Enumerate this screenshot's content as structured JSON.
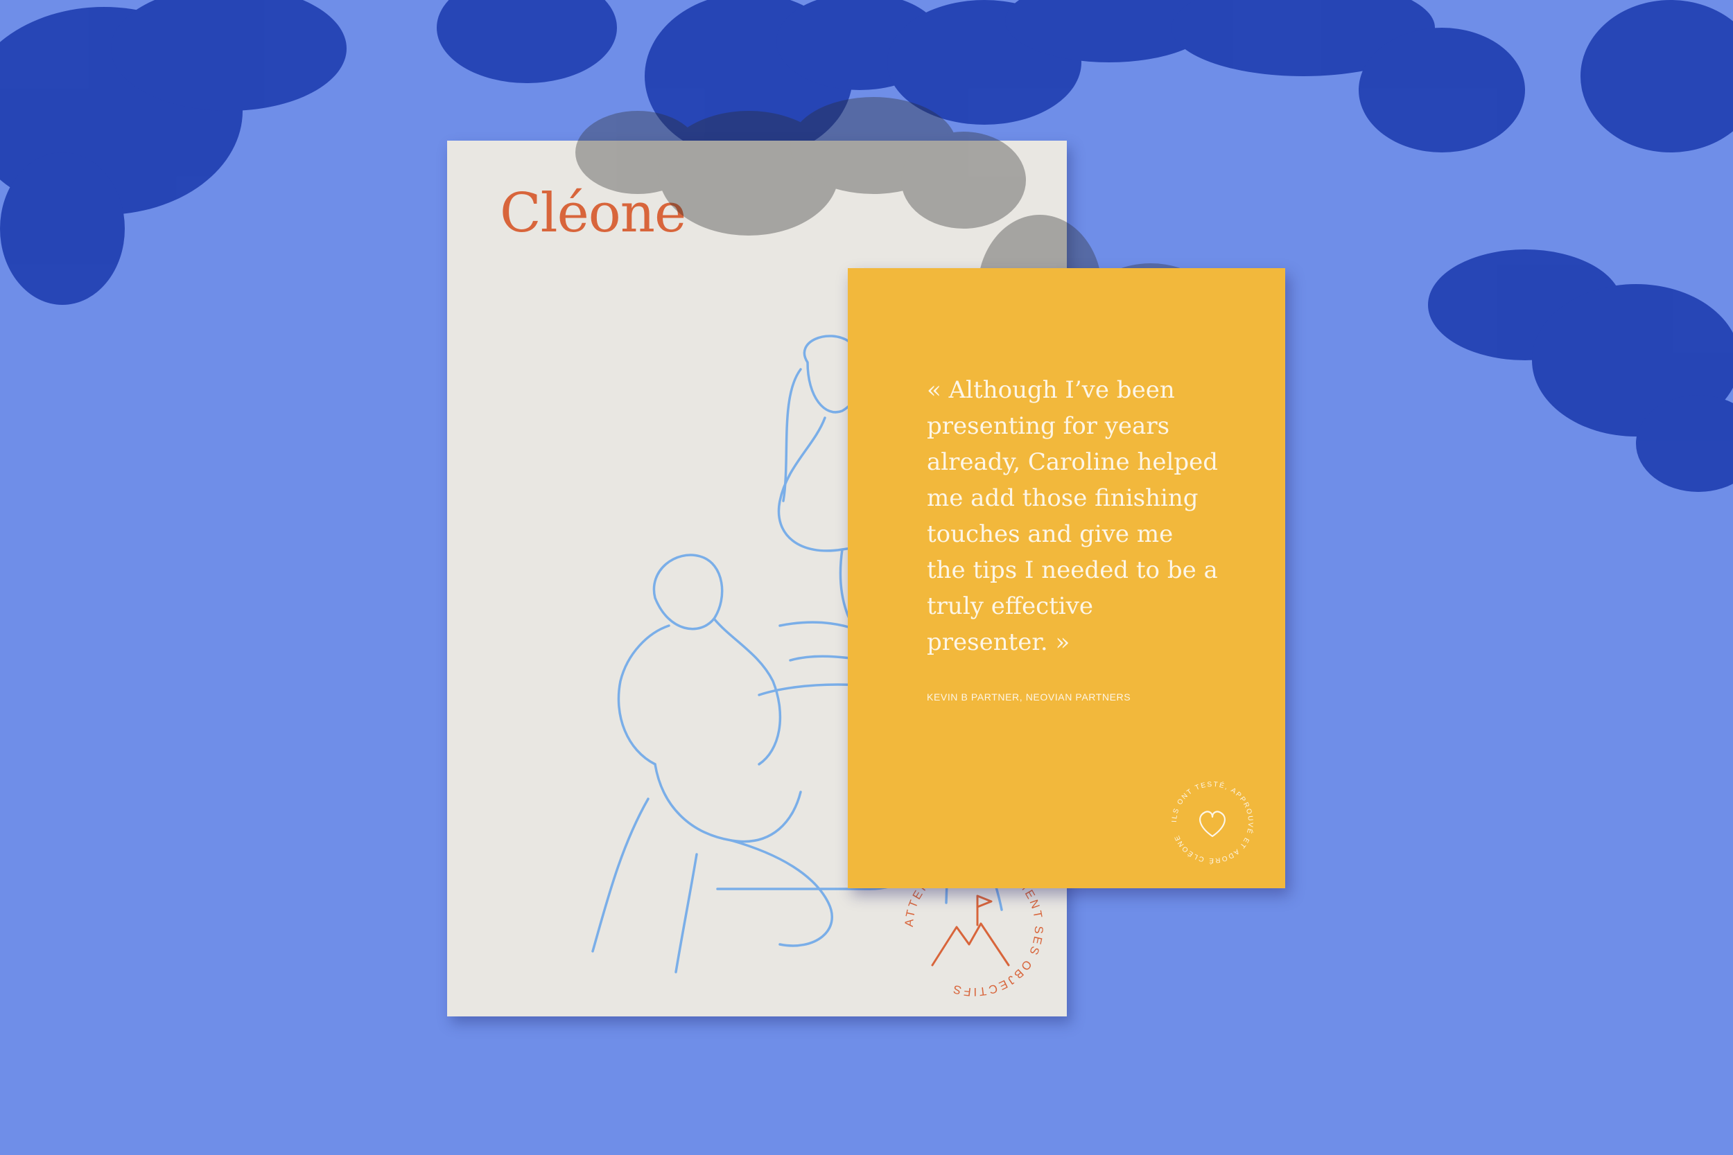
{
  "brand": {
    "name": "Cléone",
    "accent_color": "#d8653b",
    "illustration_color": "#7aaee8"
  },
  "white_card": {
    "illustration": "line-drawing-three-people-on-sofa",
    "seal": {
      "text": "ATTEINDRE FACILEMENT SES OBJECTIFS",
      "icon": "mountain-flag-icon"
    }
  },
  "yellow_card": {
    "color": "#f2b83c",
    "quote": "« Although I’ve been presenting for years already, Caroline helped me add those finishing touches and give me the tips I needed to be a truly effective presenter. »",
    "attribution": "KEVIN B PARTNER, NEOVIAN PARTNERS",
    "seal": {
      "text": "ILS ONT TESTÉ, APPROUVÉ ET ADORÉ CLÉONE",
      "icon": "heart-icon"
    }
  },
  "background": {
    "color": "#6f8ee8",
    "shadow_color": "#1d3fb0"
  }
}
